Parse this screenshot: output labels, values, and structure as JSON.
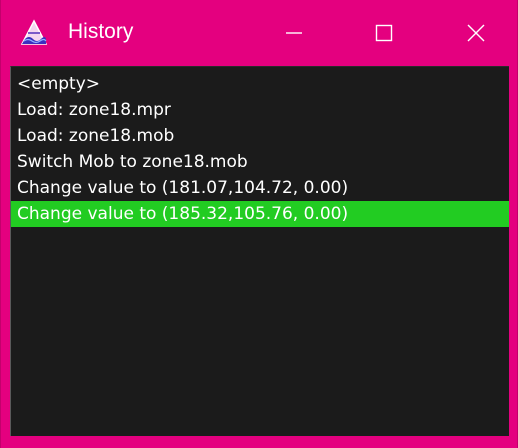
{
  "window": {
    "title": "History",
    "accent_color": "#e4007f",
    "icon": "app-icon"
  },
  "controls": {
    "minimize_icon": "minimize-icon",
    "maximize_icon": "maximize-icon",
    "close_icon": "close-icon"
  },
  "history": {
    "items": [
      {
        "label": "<empty>"
      },
      {
        "label": "Load: zone18.mpr"
      },
      {
        "label": "Load: zone18.mob"
      },
      {
        "label": "Switch Mob to zone18.mob"
      },
      {
        "label": "Change value to (181.07,104.72, 0.00)"
      },
      {
        "label": "Change value to (185.32,105.76, 0.00)"
      }
    ],
    "selected_index": 5,
    "selected_color": "#22cc22"
  }
}
